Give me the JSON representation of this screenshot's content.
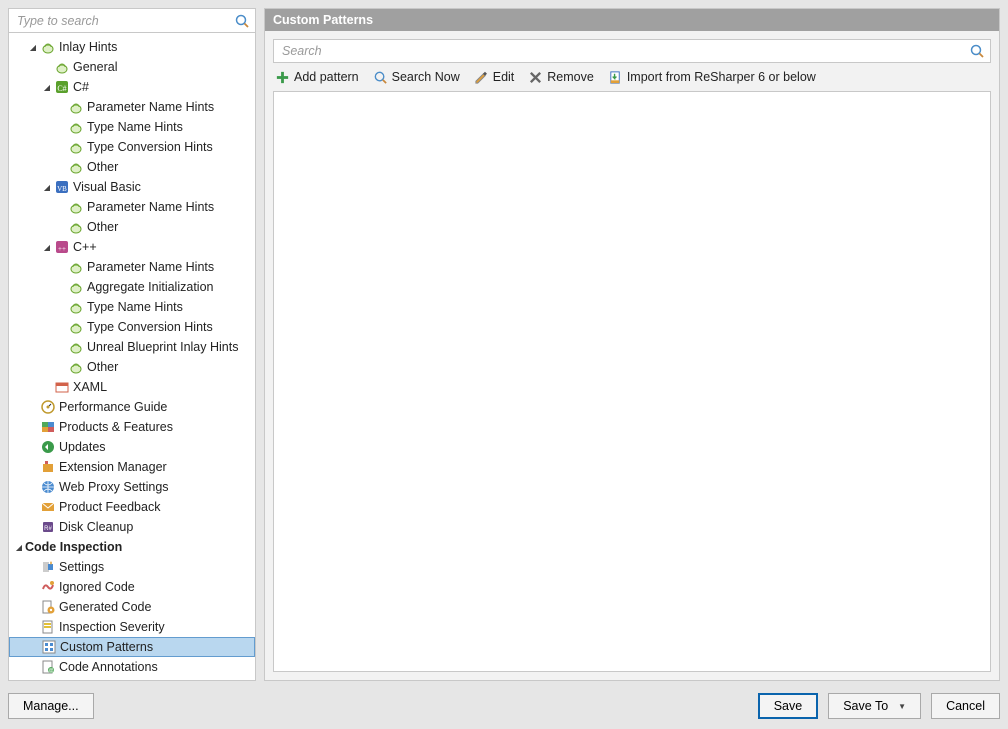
{
  "sidebar": {
    "search_placeholder": "Type to search",
    "items": [
      {
        "indent": 2,
        "arrow": "expanded",
        "icon": "hint",
        "label": "Inlay Hints",
        "bold": false
      },
      {
        "indent": 3,
        "arrow": "none",
        "icon": "hint",
        "label": "General"
      },
      {
        "indent": 3,
        "arrow": "expanded",
        "icon": "csharp",
        "label": "C#"
      },
      {
        "indent": 4,
        "arrow": "none",
        "icon": "hint",
        "label": "Parameter Name Hints"
      },
      {
        "indent": 4,
        "arrow": "none",
        "icon": "hint",
        "label": "Type Name Hints"
      },
      {
        "indent": 4,
        "arrow": "none",
        "icon": "hint",
        "label": "Type Conversion Hints"
      },
      {
        "indent": 4,
        "arrow": "none",
        "icon": "hint",
        "label": "Other"
      },
      {
        "indent": 3,
        "arrow": "expanded",
        "icon": "vb",
        "label": "Visual Basic"
      },
      {
        "indent": 4,
        "arrow": "none",
        "icon": "hint",
        "label": "Parameter Name Hints"
      },
      {
        "indent": 4,
        "arrow": "none",
        "icon": "hint",
        "label": "Other"
      },
      {
        "indent": 3,
        "arrow": "expanded",
        "icon": "cpp",
        "label": "C++"
      },
      {
        "indent": 4,
        "arrow": "none",
        "icon": "hint",
        "label": "Parameter Name Hints"
      },
      {
        "indent": 4,
        "arrow": "none",
        "icon": "hint",
        "label": "Aggregate Initialization"
      },
      {
        "indent": 4,
        "arrow": "none",
        "icon": "hint",
        "label": "Type Name Hints"
      },
      {
        "indent": 4,
        "arrow": "none",
        "icon": "hint",
        "label": "Type Conversion Hints"
      },
      {
        "indent": 4,
        "arrow": "none",
        "icon": "hint",
        "label": "Unreal Blueprint Inlay Hints"
      },
      {
        "indent": 4,
        "arrow": "none",
        "icon": "hint",
        "label": "Other"
      },
      {
        "indent": 3,
        "arrow": "none",
        "icon": "xaml",
        "label": "XAML"
      },
      {
        "indent": 2,
        "arrow": "none",
        "icon": "perf",
        "label": "Performance Guide"
      },
      {
        "indent": 2,
        "arrow": "none",
        "icon": "prod",
        "label": "Products & Features"
      },
      {
        "indent": 2,
        "arrow": "none",
        "icon": "update",
        "label": "Updates"
      },
      {
        "indent": 2,
        "arrow": "none",
        "icon": "ext",
        "label": "Extension Manager"
      },
      {
        "indent": 2,
        "arrow": "none",
        "icon": "proxy",
        "label": "Web Proxy Settings"
      },
      {
        "indent": 2,
        "arrow": "none",
        "icon": "feedback",
        "label": "Product Feedback"
      },
      {
        "indent": 2,
        "arrow": "none",
        "icon": "disk",
        "label": "Disk Cleanup"
      },
      {
        "indent": 1,
        "arrow": "expanded",
        "icon": "",
        "label": "Code Inspection",
        "bold": true
      },
      {
        "indent": 2,
        "arrow": "none",
        "icon": "settings",
        "label": "Settings"
      },
      {
        "indent": 2,
        "arrow": "none",
        "icon": "ignore",
        "label": "Ignored Code"
      },
      {
        "indent": 2,
        "arrow": "none",
        "icon": "gen",
        "label": "Generated Code"
      },
      {
        "indent": 2,
        "arrow": "none",
        "icon": "severity",
        "label": "Inspection Severity"
      },
      {
        "indent": 2,
        "arrow": "none",
        "icon": "pattern",
        "label": "Custom Patterns",
        "selected": true
      },
      {
        "indent": 2,
        "arrow": "none",
        "icon": "annot",
        "label": "Code Annotations"
      }
    ]
  },
  "main": {
    "title": "Custom Patterns",
    "search_placeholder": "Search",
    "toolbar": {
      "add": "Add pattern",
      "search_now": "Search Now",
      "edit": "Edit",
      "remove": "Remove",
      "import": "Import from ReSharper 6 or below"
    }
  },
  "buttons": {
    "manage": "Manage...",
    "save": "Save",
    "save_to": "Save To",
    "cancel": "Cancel"
  }
}
